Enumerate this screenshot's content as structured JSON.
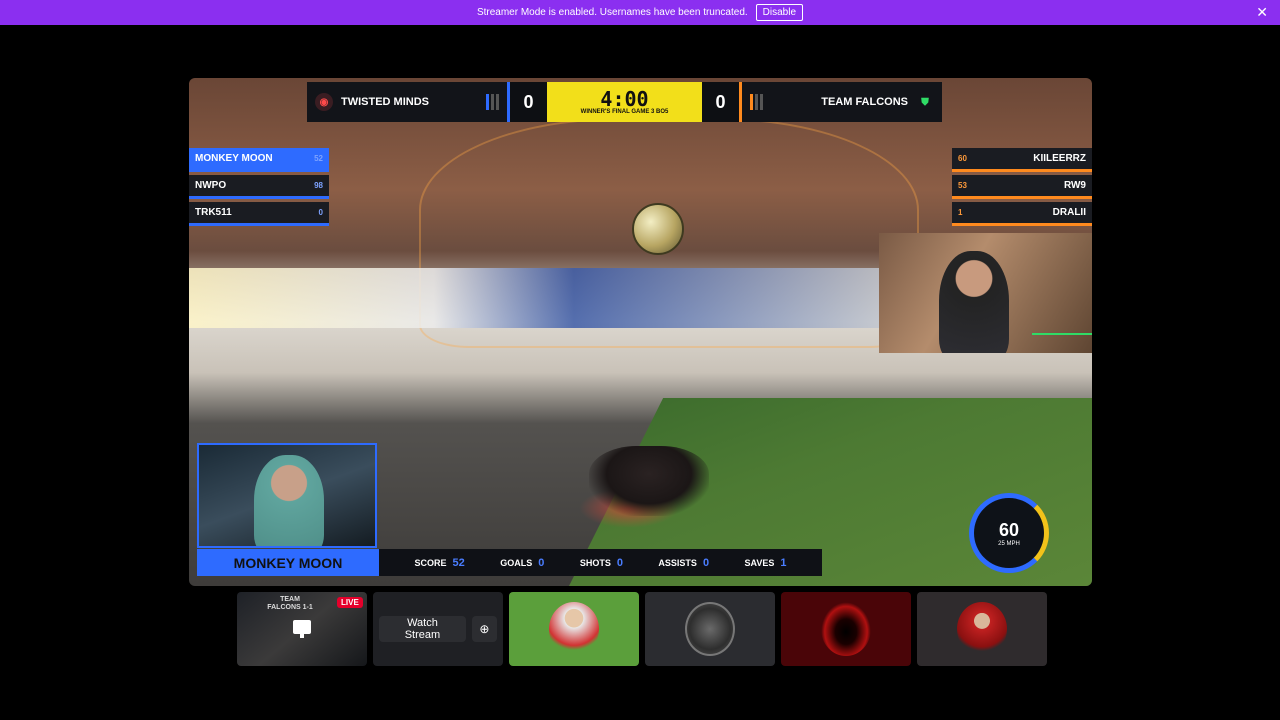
{
  "banner": {
    "message": "Streamer Mode is enabled. Usernames have been truncated.",
    "disable_label": "Disable",
    "close_glyph": "✕"
  },
  "scoreboard": {
    "left_team": "TWISTED MINDS",
    "right_team": "TEAM FALCONS",
    "left_score": "0",
    "right_score": "0",
    "clock": "4:00",
    "subtitle": "WINNER'S FINAL GAME 3 BO5",
    "left_logo_glyph": "◉",
    "right_logo_glyph": "⛊",
    "colors": {
      "blue": "#2e6bff",
      "orange": "#ff8a1e",
      "clock_bg": "#f2df1a"
    }
  },
  "left_roster": [
    {
      "name": "MONKEY MOON",
      "pts": "52"
    },
    {
      "name": "NWPO",
      "pts": "98"
    },
    {
      "name": "TRK511",
      "pts": "0"
    }
  ],
  "right_roster": [
    {
      "name": "KIILEERRZ",
      "pts": "60"
    },
    {
      "name": "RW9",
      "pts": "53"
    },
    {
      "name": "DRALII",
      "pts": "1"
    }
  ],
  "player_card": {
    "name": "MONKEY MOON",
    "stats": [
      {
        "label": "SCORE",
        "value": "52"
      },
      {
        "label": "GOALS",
        "value": "0"
      },
      {
        "label": "SHOTS",
        "value": "0"
      },
      {
        "label": "ASSISTS",
        "value": "0"
      },
      {
        "label": "SAVES",
        "value": "1"
      }
    ]
  },
  "speedometer": {
    "speed": "60",
    "unit": "25 MPH"
  },
  "tiles": {
    "live_title": "TEAM FALCONS 1-1",
    "live_badge": "LIVE",
    "watch_label": "Watch Stream",
    "watch_icon_glyph": "⊕"
  }
}
